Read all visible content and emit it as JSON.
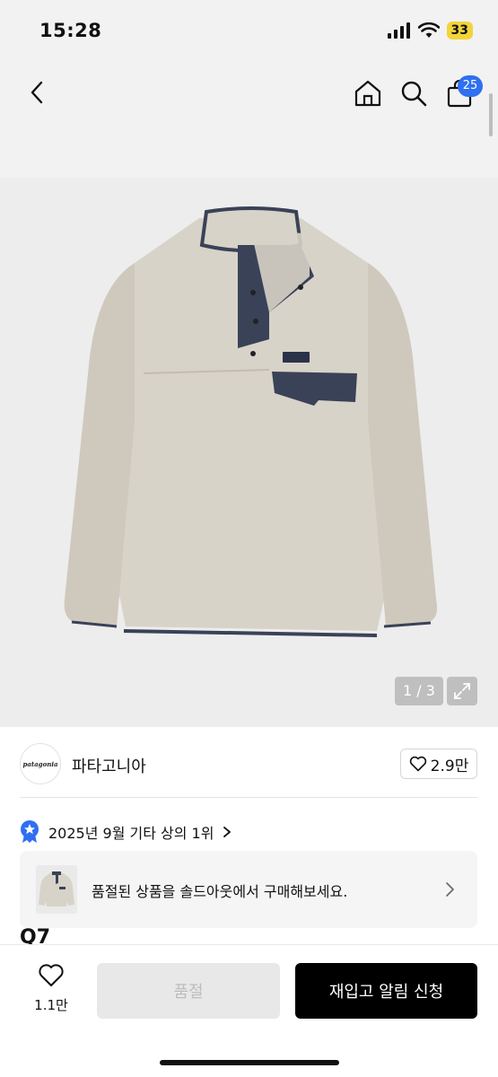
{
  "status_bar": {
    "time": "15:28",
    "battery": "33"
  },
  "nav": {
    "cart_count": "25"
  },
  "gallery": {
    "counter": "1 / 3"
  },
  "brand": {
    "logo_text": "patagonia",
    "name": "파타고니아",
    "likes": "2.9만"
  },
  "ranking": {
    "text": "2025년 9월 기타 상의 1위"
  },
  "soldout_banner": {
    "text": "품절된 상품을 솔드아웃에서 구매해보세요."
  },
  "product": {
    "title_partial": "Q7"
  },
  "bottom": {
    "wish_count": "1.1만",
    "soldout_label": "품절",
    "restock_label": "재입고 알림 신청"
  },
  "colors": {
    "accent_blue": "#2f6ff2",
    "fleece": "#d8d3c8",
    "navy_trim": "#3a4258"
  }
}
